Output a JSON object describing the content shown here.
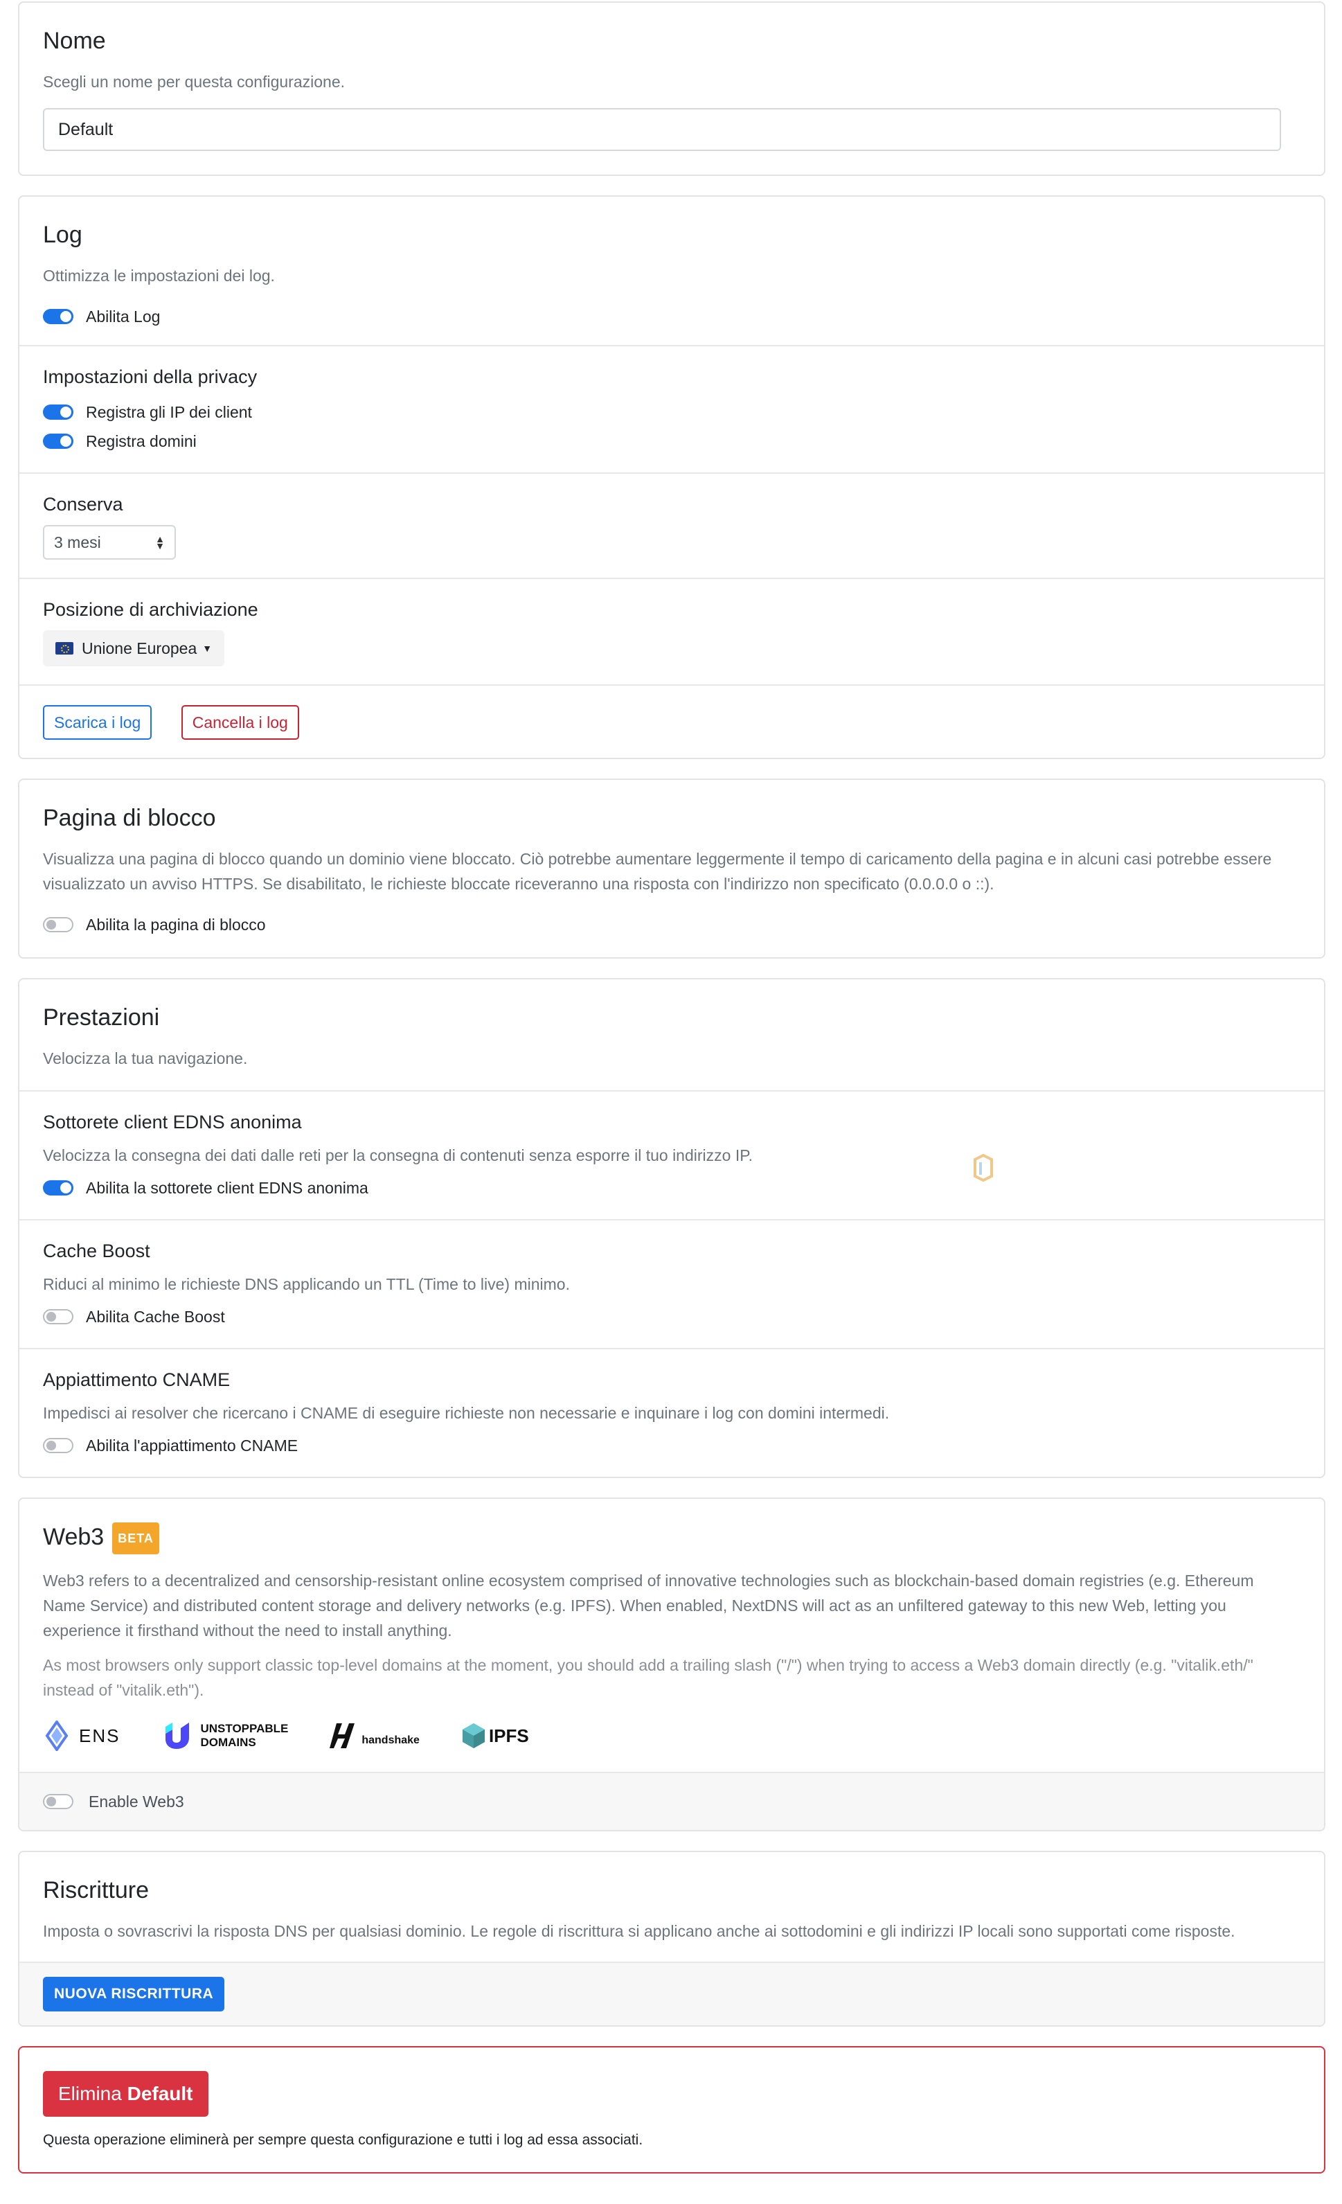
{
  "name_section": {
    "title": "Nome",
    "description": "Scegli un nome per questa configurazione.",
    "input_value": "Default"
  },
  "log_section": {
    "title": "Log",
    "description": "Ottimizza le impostazioni dei log.",
    "enable_label": "Abilita Log",
    "enable_on": true,
    "privacy_title": "Impostazioni della privacy",
    "log_client_ips_label": "Registra gli IP dei client",
    "log_domains_label": "Registra domini",
    "retention_title": "Conserva",
    "retention_value": "3 mesi",
    "storage_title": "Posizione di archiviazione",
    "storage_value": "Unione Europea",
    "download_label": "Scarica i log",
    "clear_label": "Cancella i log"
  },
  "block_page_section": {
    "title": "Pagina di blocco",
    "description": "Visualizza una pagina di blocco quando un dominio viene bloccato. Ciò potrebbe aumentare leggermente il tempo di caricamento della pagina e in alcuni casi potrebbe essere visualizzato un avviso HTTPS. Se disabilitato, le richieste bloccate riceveranno una risposta con l'indirizzo non specificato (0.0.0.0 o ::).",
    "enable_label": "Abilita la pagina di blocco"
  },
  "performance_section": {
    "title": "Prestazioni",
    "description": "Velocizza la tua navigazione.",
    "edns_title": "Sottorete client EDNS anonima",
    "edns_description": "Velocizza la consegna dei dati dalle reti per la consegna di contenuti senza esporre il tuo indirizzo IP.",
    "edns_label": "Abilita la sottorete client EDNS anonima",
    "cache_title": "Cache Boost",
    "cache_description": "Riduci al minimo le richieste DNS applicando un TTL (Time to live) minimo.",
    "cache_label": "Abilita Cache Boost",
    "cname_title": "Appiattimento CNAME",
    "cname_description": "Impedisci ai resolver che ricercano i CNAME di eseguire richieste non necessarie e inquinare i log con domini intermedi.",
    "cname_label": "Abilita l'appiattimento CNAME"
  },
  "web3_section": {
    "title": "Web3",
    "badge": "BETA",
    "description": "Web3 refers to a decentralized and censorship-resistant online ecosystem comprised of innovative technologies such as blockchain-based domain registries (e.g. Ethereum Name Service) and distributed content storage and delivery networks (e.g. IPFS). When enabled, NextDNS will act as an unfiltered gateway to this new Web, letting you experience it firsthand without the need to install anything.",
    "note": "As most browsers only support classic top-level domains at the moment, you should add a trailing slash (\"/\") when trying to access a Web3 domain directly (e.g. \"vitalik.eth/\" instead of \"vitalik.eth\").",
    "logos": {
      "ens": "ENS",
      "unstoppable_line1": "UNSTOPPABLE",
      "unstoppable_line2": "DOMAINS",
      "handshake": "handshake",
      "ipfs": "IPFS"
    },
    "enable_label": "Enable Web3"
  },
  "rewrites_section": {
    "title": "Riscritture",
    "description": "Imposta o sovrascrivi la risposta DNS per qualsiasi dominio. Le regole di riscrittura si applicano anche ai sottodomini e gli indirizzi IP locali sono supportati come risposte.",
    "new_button": "NUOVA RISCRITTURA"
  },
  "delete_section": {
    "button_prefix": "Elimina ",
    "button_name": "Default",
    "note": "Questa operazione eliminerà per sempre questa configurazione e tutti i log ad essa associati."
  },
  "colors": {
    "primary": "#1b74e8",
    "danger": "#d93240",
    "beta": "#f4a62a"
  }
}
